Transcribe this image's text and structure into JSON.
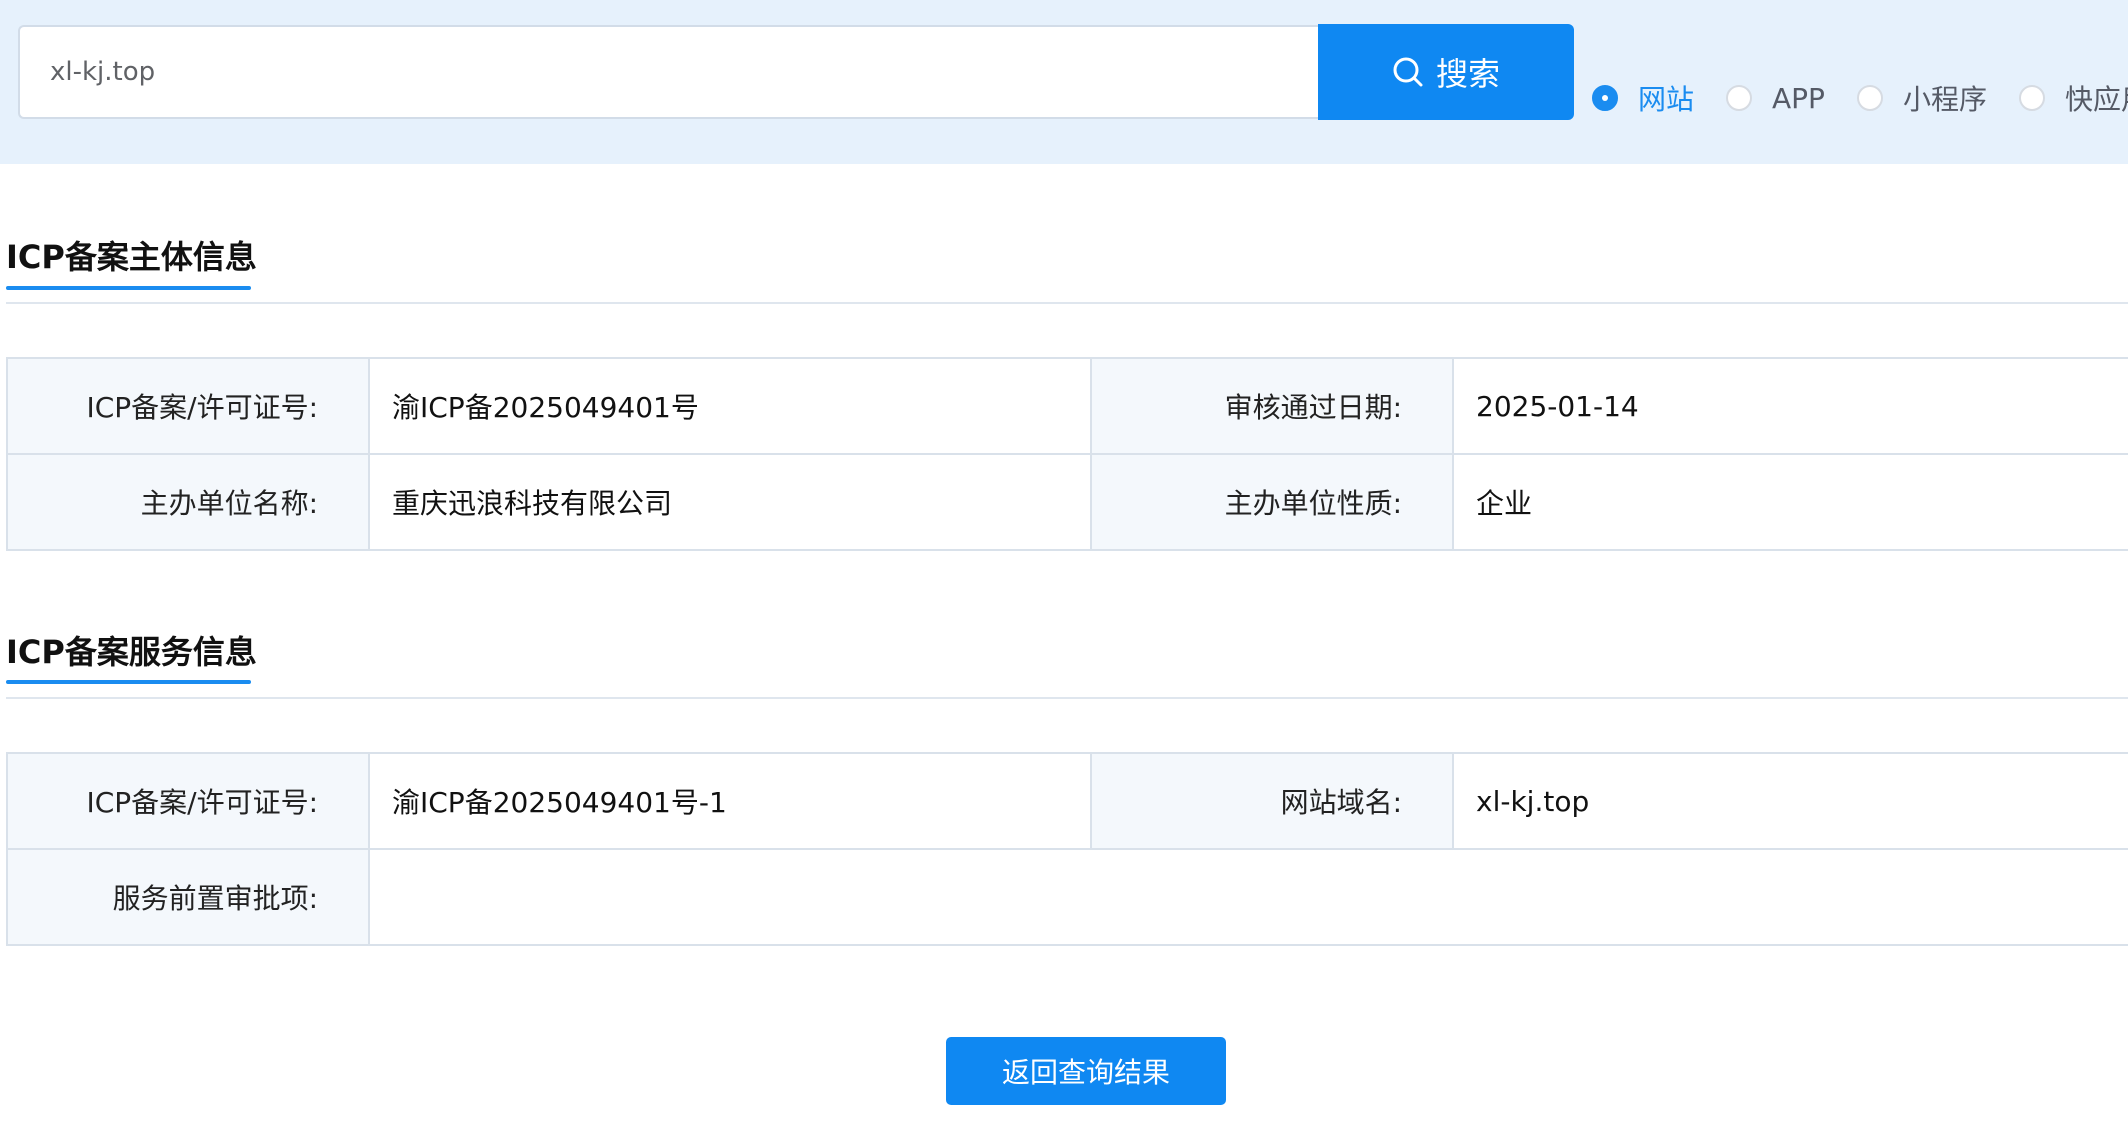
{
  "search": {
    "value": "xl-kj.top",
    "button_label": "搜索",
    "types": [
      {
        "label": "网站",
        "checked": true
      },
      {
        "label": "APP",
        "checked": false
      },
      {
        "label": "小程序",
        "checked": false
      },
      {
        "label": "快应用",
        "checked": false
      }
    ]
  },
  "subject_section": {
    "title": "ICP备案主体信息",
    "rows": [
      {
        "label1": "ICP备案/许可证号:",
        "value1": "渝ICP备2025049401号",
        "label2": "审核通过日期:",
        "value2": "2025-01-14"
      },
      {
        "label1": "主办单位名称:",
        "value1": "重庆迅浪科技有限公司",
        "label2": "主办单位性质:",
        "value2": "企业"
      }
    ]
  },
  "service_section": {
    "title": "ICP备案服务信息",
    "rows": [
      {
        "label1": "ICP备案/许可证号:",
        "value1": "渝ICP备2025049401号-1",
        "label2": "网站域名:",
        "value2": "xl-kj.top"
      },
      {
        "label1": "服务前置审批项:",
        "value1": ""
      }
    ]
  },
  "actions": {
    "back_label": "返回查询结果"
  },
  "colors": {
    "accent": "#0f88f2",
    "topbar_bg": "#e6f1fc",
    "label_bg": "#f4f8fc",
    "border": "#d9e1ea"
  }
}
